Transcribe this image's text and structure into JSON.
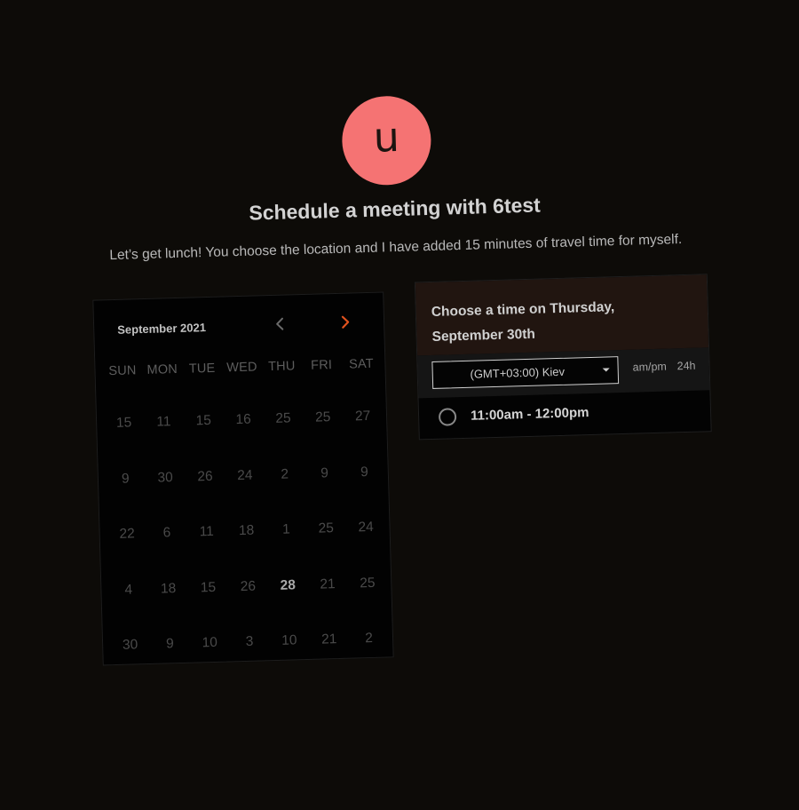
{
  "profile": {
    "avatar_letter": "u",
    "avatar_color": "#f57373"
  },
  "page": {
    "title": "Schedule a meeting with 6test",
    "description": "Let’s get lunch! You choose the location and I have added 15 minutes of travel time for myself."
  },
  "calendar": {
    "month_label": "September 2021",
    "prev_icon": "chevron-left-icon",
    "next_icon": "chevron-right-icon",
    "accent_color": "#e0521e",
    "weekdays": [
      "SUN",
      "MON",
      "TUE",
      "WED",
      "THU",
      "FRI",
      "SAT"
    ],
    "weeks": [
      [
        "15",
        "11",
        "15",
        "16",
        "25",
        "25",
        "27"
      ],
      [
        "9",
        "30",
        "26",
        "24",
        "2",
        "9",
        "9"
      ],
      [
        "22",
        "6",
        "11",
        "18",
        "1",
        "25",
        "24"
      ],
      [
        "4",
        "18",
        "15",
        "26",
        "28",
        "21",
        "25"
      ],
      [
        "30",
        "9",
        "10",
        "3",
        "10",
        "21",
        "2"
      ]
    ],
    "available_day": "28"
  },
  "time_panel": {
    "heading": "Choose a time on Thursday, September 30th",
    "timezone": "(GMT+03:00) Kiev",
    "format_ampm": "am/pm",
    "format_24h": "24h",
    "slots": [
      {
        "label": "11:00am - 12:00pm"
      }
    ]
  }
}
